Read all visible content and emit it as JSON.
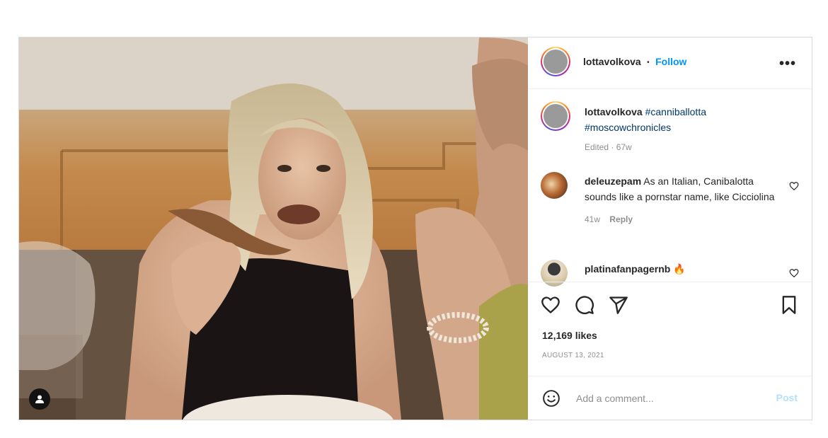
{
  "post": {
    "author": "lottavolkova",
    "dot": "•",
    "follow_label": "Follow",
    "more_label": "•••",
    "photo_alt": "Photo",
    "caption": {
      "username": "lottavolkova",
      "hashtags": [
        "#canniballotta",
        "#moscowchronicles"
      ],
      "meta": "Edited · 67w"
    },
    "comments": [
      {
        "username": "deleuzepam",
        "text": "As an Italian, Canibalotta sounds like a pornstar name, like Cicciolina",
        "age": "41w",
        "reply_label": "Reply"
      },
      {
        "username": "platinafanpagernb",
        "text": "🔥"
      }
    ],
    "likes": "12,169 likes",
    "date": "AUGUST 13, 2021",
    "add_comment_placeholder": "Add a comment...",
    "post_label": "Post"
  },
  "colors": {
    "accent": "#0095f6",
    "hashtag": "#00376b",
    "muted": "#8e8e8e",
    "post_disabled": "#b2dffc"
  }
}
